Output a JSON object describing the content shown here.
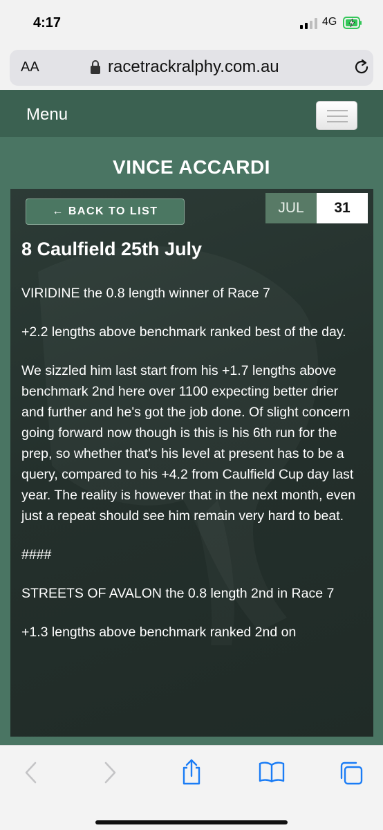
{
  "status_bar": {
    "time": "4:17",
    "network": "4G"
  },
  "browser": {
    "text_size_label": "AA",
    "url": "racetrackralphy.com.au"
  },
  "site_nav": {
    "menu_label": "Menu"
  },
  "page": {
    "heading": "VINCE ACCARDI"
  },
  "article": {
    "back_label": "← BACK TO LIST",
    "date_month": "JUL",
    "date_day": "31",
    "title": "8 Caulfield 25th July",
    "paragraphs": [
      "VIRIDINE the 0.8 length winner of Race 7",
      "+2.2 lengths above benchmark ranked best of the day.",
      "We sizzled him last start from his +1.7 lengths above benchmark 2nd here over 1100 expecting better drier and further and he's got the job done. Of slight concern going forward now though is this is his 6th run for the prep, so whether that's his level at present has to be a query, compared to his +4.2 from Caulfield Cup day last year. The reality is however that in the next month, even just a repeat should see him remain very hard to beat.",
      "####",
      "STREETS OF AVALON the 0.8 length 2nd in Race 7",
      "+1.3 lengths above benchmark ranked 2nd on"
    ]
  },
  "toolbar": {
    "icons": [
      "back-chevron-icon",
      "forward-chevron-icon",
      "share-icon",
      "bookmarks-icon",
      "tabs-icon"
    ]
  },
  "colors": {
    "nav_bg": "#3b6151",
    "page_bg": "#4a7563",
    "card_bg": "#25302c",
    "accent_button": "#4b7762",
    "ios_blue": "#1a7cf5"
  }
}
